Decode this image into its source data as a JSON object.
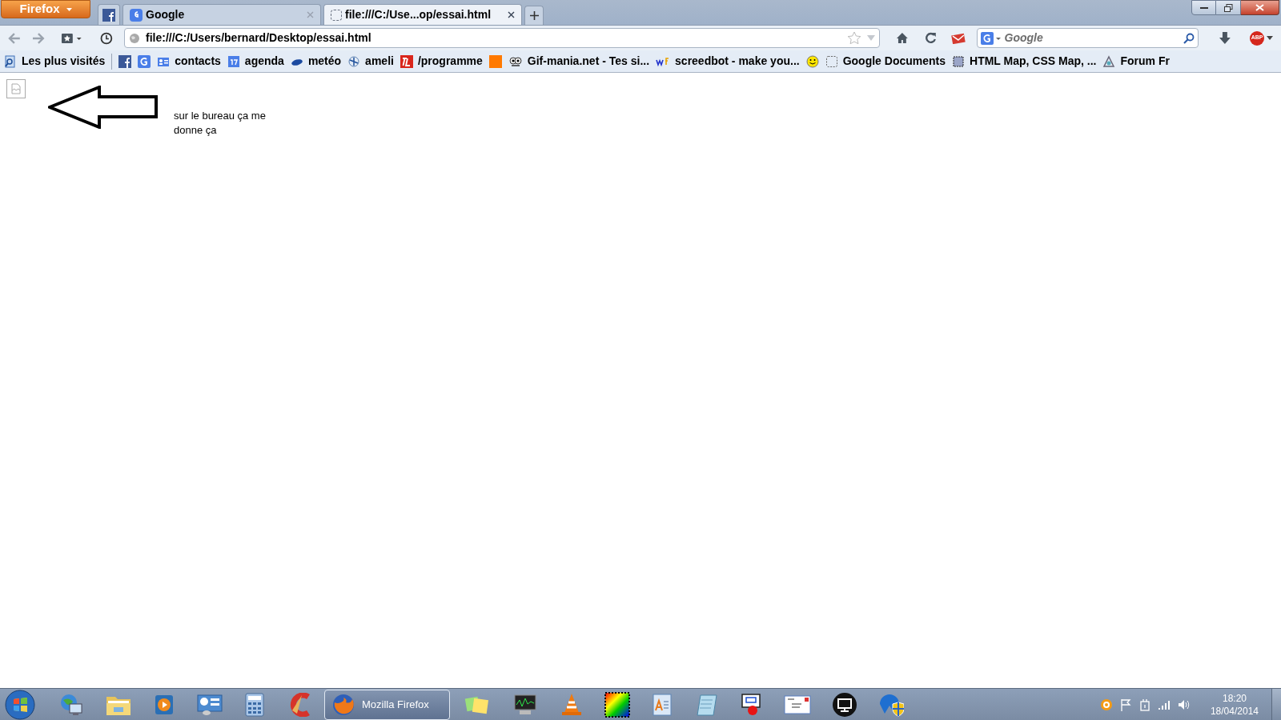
{
  "firefox_button": {
    "label": "Firefox"
  },
  "tabs": [
    {
      "kind": "pinned",
      "selected": false
    },
    {
      "kind": "normal",
      "label": "Google",
      "selected": false
    },
    {
      "kind": "normal",
      "label": "file:///C:/Use...op/essai.html",
      "selected": true
    }
  ],
  "address_bar": {
    "value": "file:///C:/Users/bernard/Desktop/essai.html"
  },
  "search": {
    "placeholder": "Google"
  },
  "adblock_badge": "ABP",
  "bookmarks": [
    {
      "kind": "visited",
      "label": "Les plus visités"
    },
    {
      "kind": "facebook"
    },
    {
      "kind": "google"
    },
    {
      "kind": "contacts",
      "label": "contacts"
    },
    {
      "kind": "calendar",
      "label": "agenda"
    },
    {
      "kind": "weather",
      "label": "metéo"
    },
    {
      "kind": "ameli",
      "label": "ameli"
    },
    {
      "kind": "tl",
      "label": "/programme"
    },
    {
      "kind": "orange"
    },
    {
      "kind": "gif",
      "label": "Gif-mania.net - Tes si..."
    },
    {
      "kind": "wf",
      "label": "screedbot - make you..."
    },
    {
      "kind": "smiley"
    },
    {
      "kind": "blank",
      "label": "Google Documents"
    },
    {
      "kind": "map",
      "label": "HTML Map, CSS Map, ..."
    },
    {
      "kind": "forum",
      "label": "Forum Fr"
    }
  ],
  "page": {
    "text": "sur le bureau ça me donne ça"
  },
  "taskbar": {
    "running_app": {
      "label": "Mozilla Firefox",
      "selected": true
    },
    "clock": {
      "time": "18:20",
      "date": "18/04/2014"
    }
  }
}
